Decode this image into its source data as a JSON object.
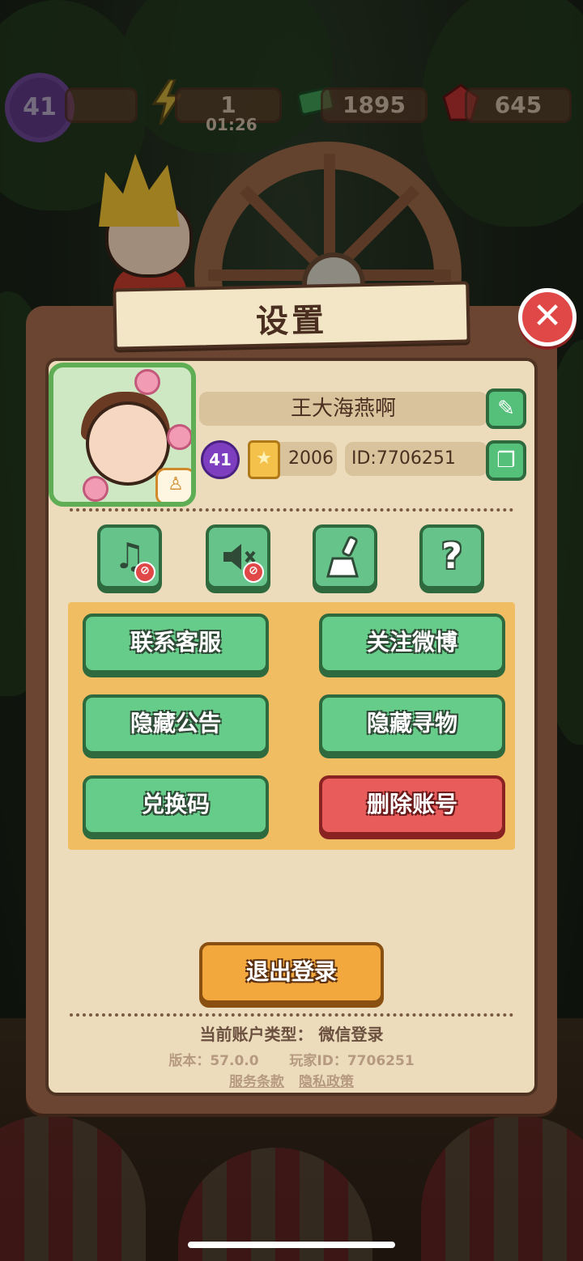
{
  "hud": {
    "player_level": "41",
    "energy": "1",
    "energy_timer": "01:26",
    "cash": "1895",
    "gems": "645"
  },
  "dialog": {
    "title": "设置",
    "close_icon": "close-x-icon"
  },
  "profile": {
    "nickname": "王大海燕啊",
    "level": "41",
    "stars": "2006",
    "id_text": "ID:7706251",
    "edit_icon": "pencil-icon",
    "copy_icon": "copy-icon"
  },
  "quick_buttons": [
    {
      "icon": "music-off-icon"
    },
    {
      "icon": "sound-off-icon"
    },
    {
      "icon": "broom-clean-icon"
    },
    {
      "icon": "help-question-icon"
    }
  ],
  "actions": {
    "contact_service": "联系客服",
    "follow_weibo": "关注微博",
    "hide_announcement": "隐藏公告",
    "hide_search": "隐藏寻物",
    "redeem_code": "兑换码",
    "delete_account": "删除账号"
  },
  "logout": "退出登录",
  "footer": {
    "account_type": "当前账户类型：  微信登录",
    "version": "版本：57.0.0",
    "player_id": "玩家ID：7706251",
    "terms": "服务条款",
    "privacy": "隐私政策"
  },
  "colors": {
    "green_button": "#66cc8a",
    "red_button": "#e85c5c",
    "orange_button": "#f3a83e",
    "panel": "#ecdcbc"
  }
}
